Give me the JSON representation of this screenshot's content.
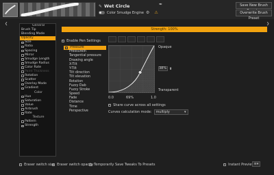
{
  "header": {
    "preset_name": "Wet Circle",
    "engine_label": "Color Smudge Engine",
    "save_new_label": "Save New Brush Preset...",
    "overwrite_label": "Overwrite Brush Preset"
  },
  "strength_bar": {
    "label": "Strength: 100%",
    "value_percent": 100,
    "color": "#f2a30f"
  },
  "params": [
    {
      "label": "General",
      "type": "header"
    },
    {
      "label": "Brush Tip"
    },
    {
      "label": "Blending Mode"
    },
    {
      "label": "Opacity",
      "selected": true
    },
    {
      "label": "Size",
      "checked": true
    },
    {
      "label": "Ratio",
      "checked": false
    },
    {
      "label": "Spacing",
      "checked": false
    },
    {
      "label": "Mirror",
      "checked": false
    },
    {
      "label": "Smudge Length",
      "checked": true
    },
    {
      "label": "Smudge Radius",
      "checked": true
    },
    {
      "label": "Color Rate",
      "checked": true
    },
    {
      "label": "Paint Thickness",
      "dim": true
    },
    {
      "label": "Rotation",
      "checked": false
    },
    {
      "label": "Scatter",
      "checked": false
    },
    {
      "label": "Overlay Mode",
      "checked": false
    },
    {
      "label": "Gradient",
      "checked": false
    },
    {
      "label": "Color",
      "type": "header"
    },
    {
      "label": "Hue",
      "checked": false
    },
    {
      "label": "Saturation",
      "checked": false
    },
    {
      "label": "Value",
      "checked": false
    },
    {
      "label": "Airbrush",
      "checked": false
    },
    {
      "label": "Rate",
      "checked": false
    },
    {
      "label": "Texture",
      "type": "header"
    },
    {
      "label": "Pattern",
      "checked": false
    },
    {
      "label": "Strength",
      "checked": true
    }
  ],
  "enable_pen_settings": "Enable Pen Settings",
  "sensors": [
    {
      "label": "Pressure",
      "selected": true,
      "checked": true
    },
    {
      "label": "PressureIn"
    },
    {
      "label": "Tangential pressure"
    },
    {
      "label": "Drawing angle"
    },
    {
      "label": "X-Tilt"
    },
    {
      "label": "Y-Tilt"
    },
    {
      "label": "Tilt direction"
    },
    {
      "label": "Tilt elevation"
    },
    {
      "label": "Rotation"
    },
    {
      "label": "Fuzzy Dab"
    },
    {
      "label": "Fuzzy Stroke"
    },
    {
      "label": "Speed"
    },
    {
      "label": "Fade"
    },
    {
      "label": "Distance"
    },
    {
      "label": "Time"
    },
    {
      "label": "Perspective"
    }
  ],
  "curve": {
    "opaque_label": "Opaque",
    "transparent_label": "Transparent",
    "value_field": "38%",
    "x_min": "0.0",
    "x_mid": "69%",
    "x_max": "1.0"
  },
  "share_curve_label": "Share curve across all settings",
  "curves_calc_label": "Curves calculation mode:",
  "curves_calc_value": "multiply",
  "footer": {
    "eraser_size": "Eraser switch size",
    "eraser_opacity": "Eraser switch opacity",
    "temp_save": "Temporarily Save Tweaks To Presets",
    "instant_preview": "Instant Preview"
  }
}
